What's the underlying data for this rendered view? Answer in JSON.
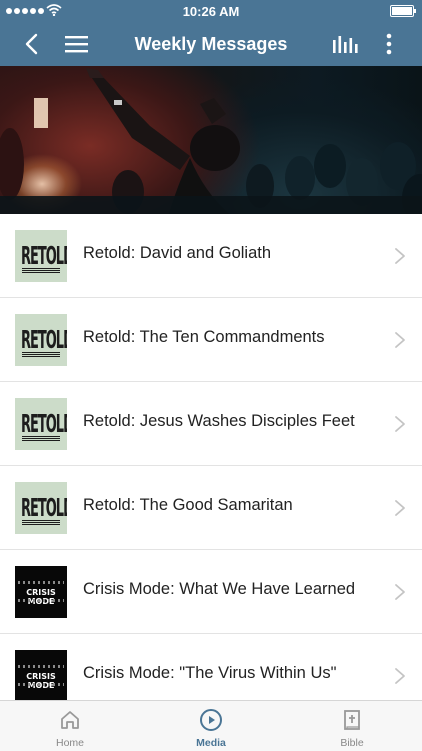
{
  "status_bar": {
    "time": "10:26 AM"
  },
  "nav": {
    "title": "Weekly Messages"
  },
  "hero": {
    "alt": "Worship crowd with raised hands"
  },
  "messages": [
    {
      "title": "Retold: David and Goliath",
      "thumb_text": "RETOLD",
      "series": "retold"
    },
    {
      "title": "Retold: The Ten Commandments",
      "thumb_text": "RETOLD",
      "series": "retold"
    },
    {
      "title": "Retold: Jesus Washes Disciples Feet",
      "thumb_text": "RETOLD",
      "series": "retold"
    },
    {
      "title": "Retold: The Good Samaritan",
      "thumb_text": "RETOLD",
      "series": "retold"
    },
    {
      "title": "Crisis Mode: What We Have Learned",
      "thumb_text": "CRISIS MODE",
      "series": "crisis"
    },
    {
      "title": "Crisis Mode: \"The Virus Within Us\"",
      "thumb_text": "CRISIS MODE",
      "series": "crisis"
    }
  ],
  "tabs": [
    {
      "label": "Home",
      "icon": "home-icon",
      "active": false
    },
    {
      "label": "Media",
      "icon": "play-circle-icon",
      "active": true
    },
    {
      "label": "Bible",
      "icon": "bible-icon",
      "active": false
    }
  ],
  "colors": {
    "brand": "#4a7595",
    "thumb_retold": "#ccdcc9",
    "thumb_crisis": "#080808"
  }
}
